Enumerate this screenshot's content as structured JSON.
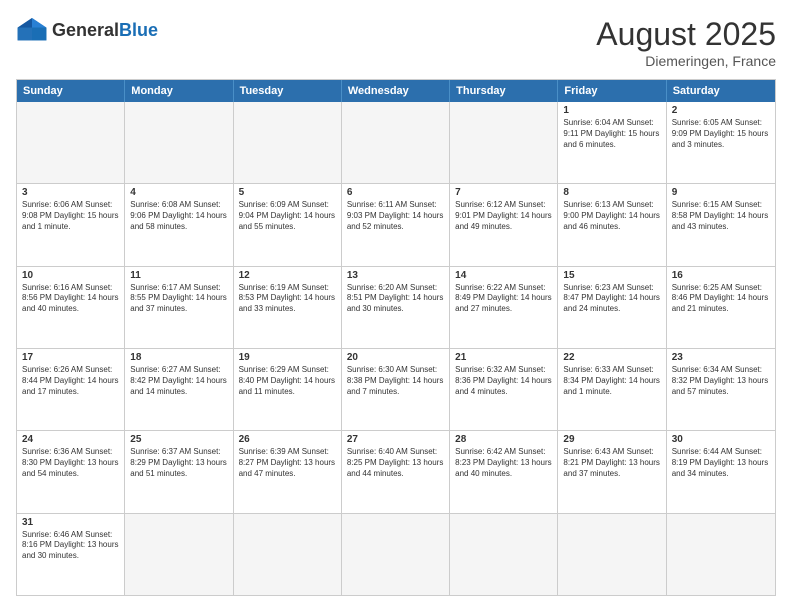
{
  "header": {
    "logo_general": "General",
    "logo_blue": "Blue",
    "month_title": "August 2025",
    "location": "Diemeringen, France"
  },
  "days_of_week": [
    "Sunday",
    "Monday",
    "Tuesday",
    "Wednesday",
    "Thursday",
    "Friday",
    "Saturday"
  ],
  "weeks": [
    [
      {
        "day": "",
        "info": ""
      },
      {
        "day": "",
        "info": ""
      },
      {
        "day": "",
        "info": ""
      },
      {
        "day": "",
        "info": ""
      },
      {
        "day": "",
        "info": ""
      },
      {
        "day": "1",
        "info": "Sunrise: 6:04 AM\nSunset: 9:11 PM\nDaylight: 15 hours and 6 minutes."
      },
      {
        "day": "2",
        "info": "Sunrise: 6:05 AM\nSunset: 9:09 PM\nDaylight: 15 hours and 3 minutes."
      }
    ],
    [
      {
        "day": "3",
        "info": "Sunrise: 6:06 AM\nSunset: 9:08 PM\nDaylight: 15 hours and 1 minute."
      },
      {
        "day": "4",
        "info": "Sunrise: 6:08 AM\nSunset: 9:06 PM\nDaylight: 14 hours and 58 minutes."
      },
      {
        "day": "5",
        "info": "Sunrise: 6:09 AM\nSunset: 9:04 PM\nDaylight: 14 hours and 55 minutes."
      },
      {
        "day": "6",
        "info": "Sunrise: 6:11 AM\nSunset: 9:03 PM\nDaylight: 14 hours and 52 minutes."
      },
      {
        "day": "7",
        "info": "Sunrise: 6:12 AM\nSunset: 9:01 PM\nDaylight: 14 hours and 49 minutes."
      },
      {
        "day": "8",
        "info": "Sunrise: 6:13 AM\nSunset: 9:00 PM\nDaylight: 14 hours and 46 minutes."
      },
      {
        "day": "9",
        "info": "Sunrise: 6:15 AM\nSunset: 8:58 PM\nDaylight: 14 hours and 43 minutes."
      }
    ],
    [
      {
        "day": "10",
        "info": "Sunrise: 6:16 AM\nSunset: 8:56 PM\nDaylight: 14 hours and 40 minutes."
      },
      {
        "day": "11",
        "info": "Sunrise: 6:17 AM\nSunset: 8:55 PM\nDaylight: 14 hours and 37 minutes."
      },
      {
        "day": "12",
        "info": "Sunrise: 6:19 AM\nSunset: 8:53 PM\nDaylight: 14 hours and 33 minutes."
      },
      {
        "day": "13",
        "info": "Sunrise: 6:20 AM\nSunset: 8:51 PM\nDaylight: 14 hours and 30 minutes."
      },
      {
        "day": "14",
        "info": "Sunrise: 6:22 AM\nSunset: 8:49 PM\nDaylight: 14 hours and 27 minutes."
      },
      {
        "day": "15",
        "info": "Sunrise: 6:23 AM\nSunset: 8:47 PM\nDaylight: 14 hours and 24 minutes."
      },
      {
        "day": "16",
        "info": "Sunrise: 6:25 AM\nSunset: 8:46 PM\nDaylight: 14 hours and 21 minutes."
      }
    ],
    [
      {
        "day": "17",
        "info": "Sunrise: 6:26 AM\nSunset: 8:44 PM\nDaylight: 14 hours and 17 minutes."
      },
      {
        "day": "18",
        "info": "Sunrise: 6:27 AM\nSunset: 8:42 PM\nDaylight: 14 hours and 14 minutes."
      },
      {
        "day": "19",
        "info": "Sunrise: 6:29 AM\nSunset: 8:40 PM\nDaylight: 14 hours and 11 minutes."
      },
      {
        "day": "20",
        "info": "Sunrise: 6:30 AM\nSunset: 8:38 PM\nDaylight: 14 hours and 7 minutes."
      },
      {
        "day": "21",
        "info": "Sunrise: 6:32 AM\nSunset: 8:36 PM\nDaylight: 14 hours and 4 minutes."
      },
      {
        "day": "22",
        "info": "Sunrise: 6:33 AM\nSunset: 8:34 PM\nDaylight: 14 hours and 1 minute."
      },
      {
        "day": "23",
        "info": "Sunrise: 6:34 AM\nSunset: 8:32 PM\nDaylight: 13 hours and 57 minutes."
      }
    ],
    [
      {
        "day": "24",
        "info": "Sunrise: 6:36 AM\nSunset: 8:30 PM\nDaylight: 13 hours and 54 minutes."
      },
      {
        "day": "25",
        "info": "Sunrise: 6:37 AM\nSunset: 8:29 PM\nDaylight: 13 hours and 51 minutes."
      },
      {
        "day": "26",
        "info": "Sunrise: 6:39 AM\nSunset: 8:27 PM\nDaylight: 13 hours and 47 minutes."
      },
      {
        "day": "27",
        "info": "Sunrise: 6:40 AM\nSunset: 8:25 PM\nDaylight: 13 hours and 44 minutes."
      },
      {
        "day": "28",
        "info": "Sunrise: 6:42 AM\nSunset: 8:23 PM\nDaylight: 13 hours and 40 minutes."
      },
      {
        "day": "29",
        "info": "Sunrise: 6:43 AM\nSunset: 8:21 PM\nDaylight: 13 hours and 37 minutes."
      },
      {
        "day": "30",
        "info": "Sunrise: 6:44 AM\nSunset: 8:19 PM\nDaylight: 13 hours and 34 minutes."
      }
    ],
    [
      {
        "day": "31",
        "info": "Sunrise: 6:46 AM\nSunset: 8:16 PM\nDaylight: 13 hours and 30 minutes."
      },
      {
        "day": "",
        "info": ""
      },
      {
        "day": "",
        "info": ""
      },
      {
        "day": "",
        "info": ""
      },
      {
        "day": "",
        "info": ""
      },
      {
        "day": "",
        "info": ""
      },
      {
        "day": "",
        "info": ""
      }
    ]
  ]
}
